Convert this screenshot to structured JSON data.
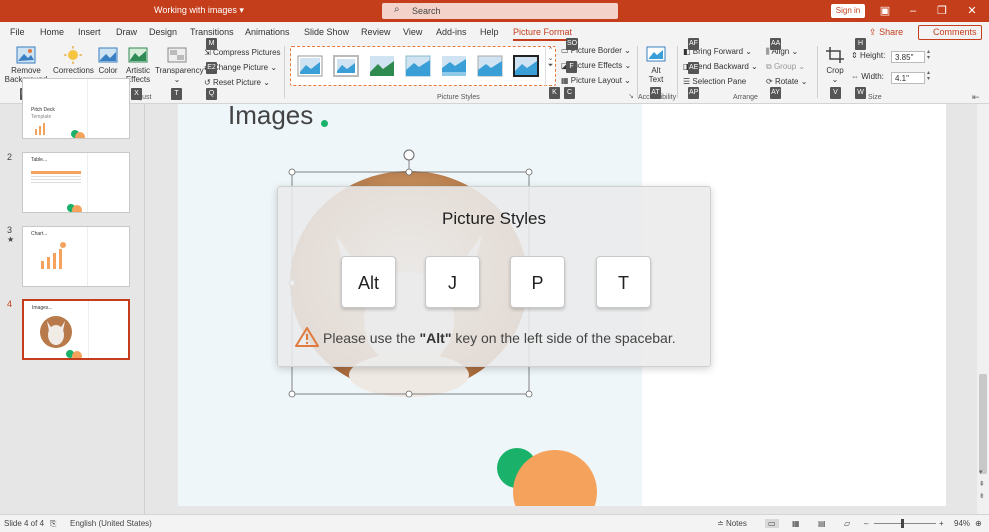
{
  "app": {
    "doc_title": "Working with images",
    "doc_title_caret": "▾",
    "search_placeholder": "Search",
    "signin_label": "Sign in",
    "accent": "#c43e1c"
  },
  "tabs": [
    {
      "label": "File"
    },
    {
      "label": "Home"
    },
    {
      "label": "Insert"
    },
    {
      "label": "Draw"
    },
    {
      "label": "Design"
    },
    {
      "label": "Transitions"
    },
    {
      "label": "Animations"
    },
    {
      "label": "Slide Show"
    },
    {
      "label": "Review"
    },
    {
      "label": "View"
    },
    {
      "label": "Add-ins"
    },
    {
      "label": "Help"
    },
    {
      "label": "Picture Format"
    }
  ],
  "header_actions": {
    "share": "Share",
    "comments": "Comments"
  },
  "ribbon": {
    "remove_background": "Remove Background",
    "corrections": "Corrections",
    "color": "Color",
    "artistic_effects": "Artistic Effects",
    "transparency": "Transparency",
    "compress_pictures": "Compress Pictures",
    "change_picture": "Change Picture",
    "reset_picture": "Reset Picture",
    "adjust_group": "Adjust",
    "picture_styles_group": "Picture Styles",
    "picture_border": "Picture Border",
    "picture_effects": "Picture Effects",
    "picture_layout": "Picture Layout",
    "alt_text": "Alt Text",
    "accessibility_group": "Accessibility",
    "bring_forward": "Bring Forward",
    "send_backward": "Send Backward",
    "selection_pane": "Selection Pane",
    "align": "Align",
    "group": "Group",
    "rotate": "Rotate",
    "arrange_group": "Arrange",
    "crop": "Crop",
    "height_label": "Height:",
    "height_value": "3.85\"",
    "width_label": "Width:",
    "width_value": "4.1\"",
    "size_group": "Size"
  },
  "keytips": {
    "e1": "E1",
    "r": "R",
    "i": "I",
    "x": "X",
    "t": "T",
    "m": "M",
    "e2": "E2",
    "q": "Q",
    "so": "SO",
    "f": "F",
    "k": "K",
    "c": "C",
    "at": "AT",
    "af": "AF",
    "ae": "AE",
    "ap": "AP",
    "aa": "AA",
    "ay": "AY",
    "h": "H",
    "w": "W",
    "v": "V",
    "o": "O",
    "sz": "SZ"
  },
  "slides": [
    {
      "num": "1",
      "title": "Pitch Deck",
      "subtitle": "Template"
    },
    {
      "num": "2",
      "title": "Table..."
    },
    {
      "num": "3",
      "title": "Chart..."
    },
    {
      "num": "4",
      "title": "Images..."
    }
  ],
  "slide3_marker": "★",
  "canvas": {
    "heading": "Images"
  },
  "overlay": {
    "title": "Picture Styles",
    "keys": [
      "Alt",
      "J",
      "P",
      "T"
    ],
    "message_before": "Please use the ",
    "message_key": "\"Alt\"",
    "message_after": " key on the left side of the spacebar."
  },
  "status": {
    "slide_info": "Slide 4 of 4",
    "language": "English (United States)",
    "notes": "Notes",
    "zoom": "94%"
  }
}
